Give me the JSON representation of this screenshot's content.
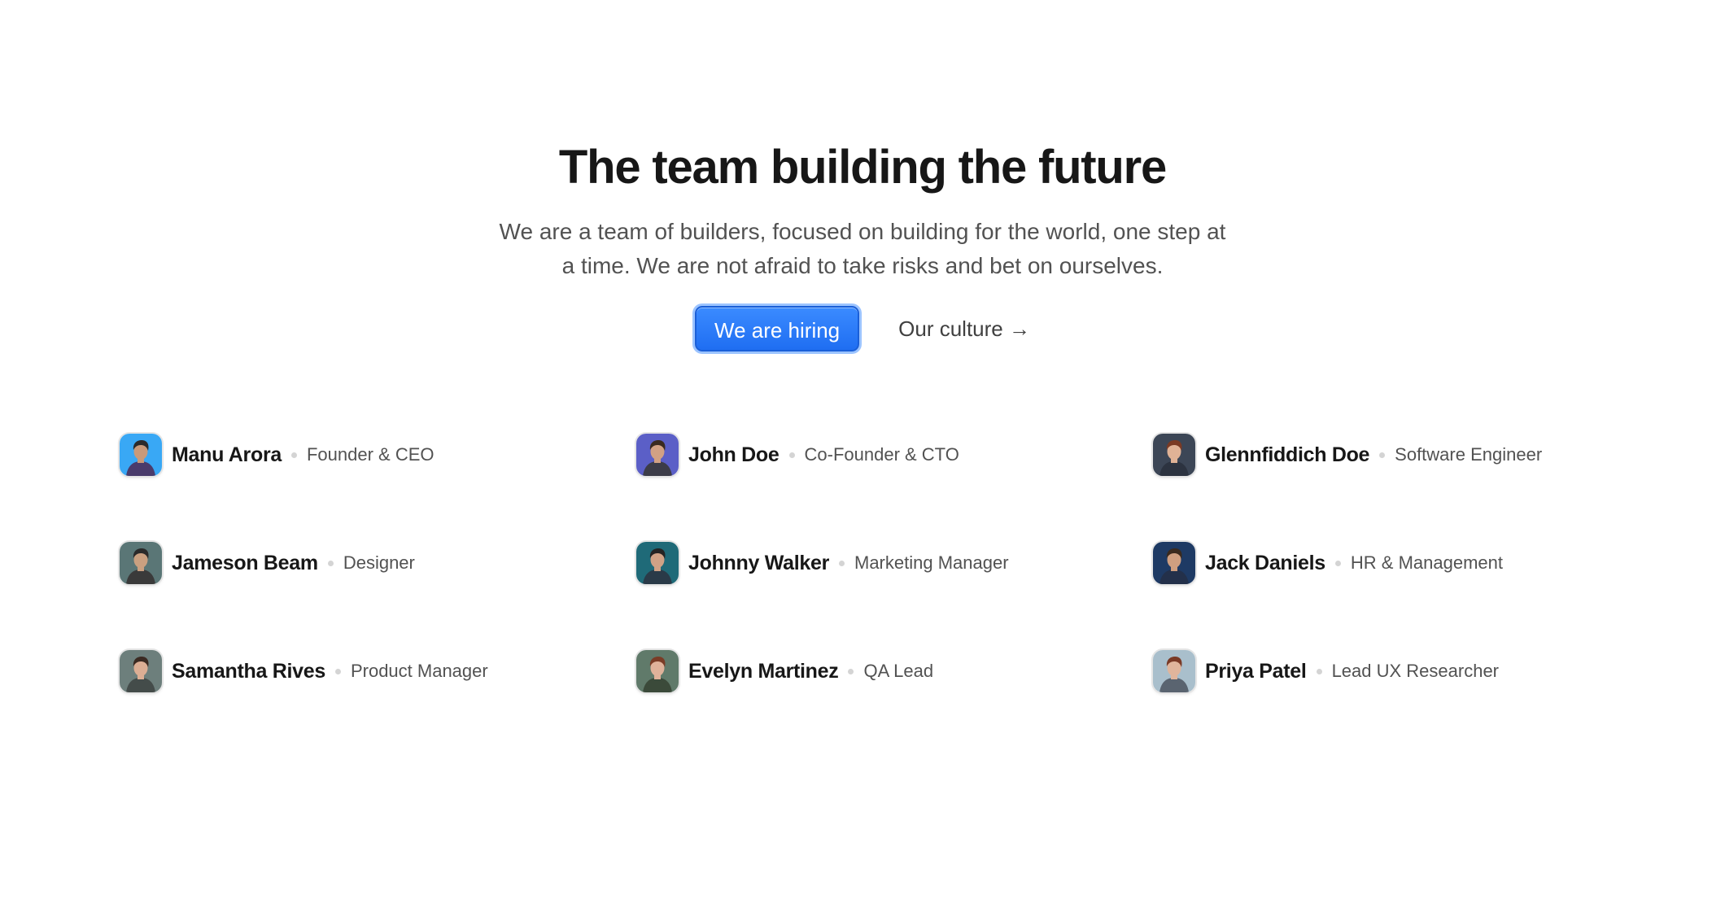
{
  "hero": {
    "title": "The team building the future",
    "subtitle": "We are a team of builders, focused on building for the world, one step at a time. We are not afraid to take risks and bet on ourselves.",
    "primary_button": "We are hiring",
    "secondary_link": "Our culture →"
  },
  "team": [
    {
      "name": "Manu Arora",
      "role": "Founder & CEO",
      "avatar_bg": "#39a8f5",
      "hair": "#2b2b2b",
      "skin": "#c99a7a",
      "shirt": "#4a3b6b"
    },
    {
      "name": "John Doe",
      "role": "Co-Founder & CTO",
      "avatar_bg": "#5b5fc7",
      "hair": "#3a2a20",
      "skin": "#d2a184",
      "shirt": "#3c3c48"
    },
    {
      "name": "Glennfiddich Doe",
      "role": "Software Engineer",
      "avatar_bg": "#3c4656",
      "hair": "#7a3a24",
      "skin": "#e0b296",
      "shirt": "#2c3340"
    },
    {
      "name": "Jameson Beam",
      "role": "Designer",
      "avatar_bg": "#5a7676",
      "hair": "#2a2a2a",
      "skin": "#caa080",
      "shirt": "#3a3a3a"
    },
    {
      "name": "Johnny Walker",
      "role": "Marketing Manager",
      "avatar_bg": "#1f6a78",
      "hair": "#242424",
      "skin": "#d0a286",
      "shirt": "#2a3a48"
    },
    {
      "name": "Jack Daniels",
      "role": "HR & Management",
      "avatar_bg": "#1e3a64",
      "hair": "#3a2a1e",
      "skin": "#cf9f80",
      "shirt": "#23304a"
    },
    {
      "name": "Samantha Rives",
      "role": "Product Manager",
      "avatar_bg": "#6d7f7c",
      "hair": "#3b2a22",
      "skin": "#dcae94",
      "shirt": "#444c4a"
    },
    {
      "name": "Evelyn Martinez",
      "role": "QA Lead",
      "avatar_bg": "#607a6a",
      "hair": "#7a3c26",
      "skin": "#dfb29a",
      "shirt": "#3b4a3a"
    },
    {
      "name": "Priya Patel",
      "role": "Lead UX Researcher",
      "avatar_bg": "#a9bfcc",
      "hair": "#7a3a26",
      "skin": "#e0b59c",
      "shirt": "#5a6470"
    }
  ]
}
